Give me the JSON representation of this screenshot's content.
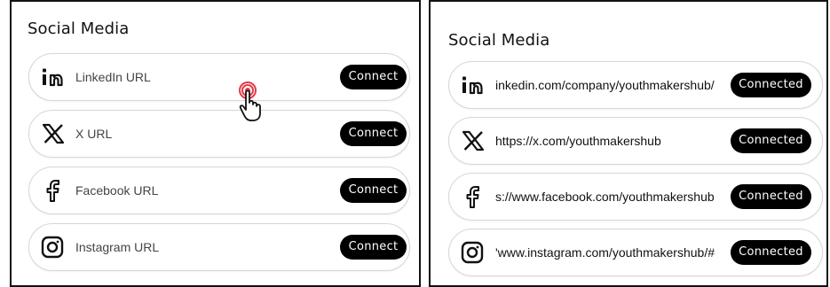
{
  "left_panel": {
    "title": "Social Media",
    "rows": [
      {
        "icon": "linkedin-icon",
        "placeholder": "LinkedIn URL",
        "button": "Connect"
      },
      {
        "icon": "x-icon",
        "placeholder": "X URL",
        "button": "Connect"
      },
      {
        "icon": "facebook-icon",
        "placeholder": "Facebook URL",
        "button": "Connect"
      },
      {
        "icon": "instagram-icon",
        "placeholder": "Instagram URL",
        "button": "Connect"
      }
    ]
  },
  "right_panel": {
    "title": "Social Media",
    "rows": [
      {
        "icon": "linkedin-icon",
        "value": "inkedin.com/company/youthmakershub/",
        "button": "Connected"
      },
      {
        "icon": "x-icon",
        "value": "https://x.com/youthmakershub",
        "button": "Connected"
      },
      {
        "icon": "facebook-icon",
        "value": "s://www.facebook.com/youthmakershub",
        "button": "Connected"
      },
      {
        "icon": "instagram-icon",
        "value": "'www.instagram.com/youthmakershub/#",
        "button": "Connected"
      }
    ]
  },
  "colors": {
    "button_bg": "#000000",
    "button_text": "#ffffff",
    "row_border": "#d6d6d6",
    "click_indicator": "#e23b4a"
  }
}
